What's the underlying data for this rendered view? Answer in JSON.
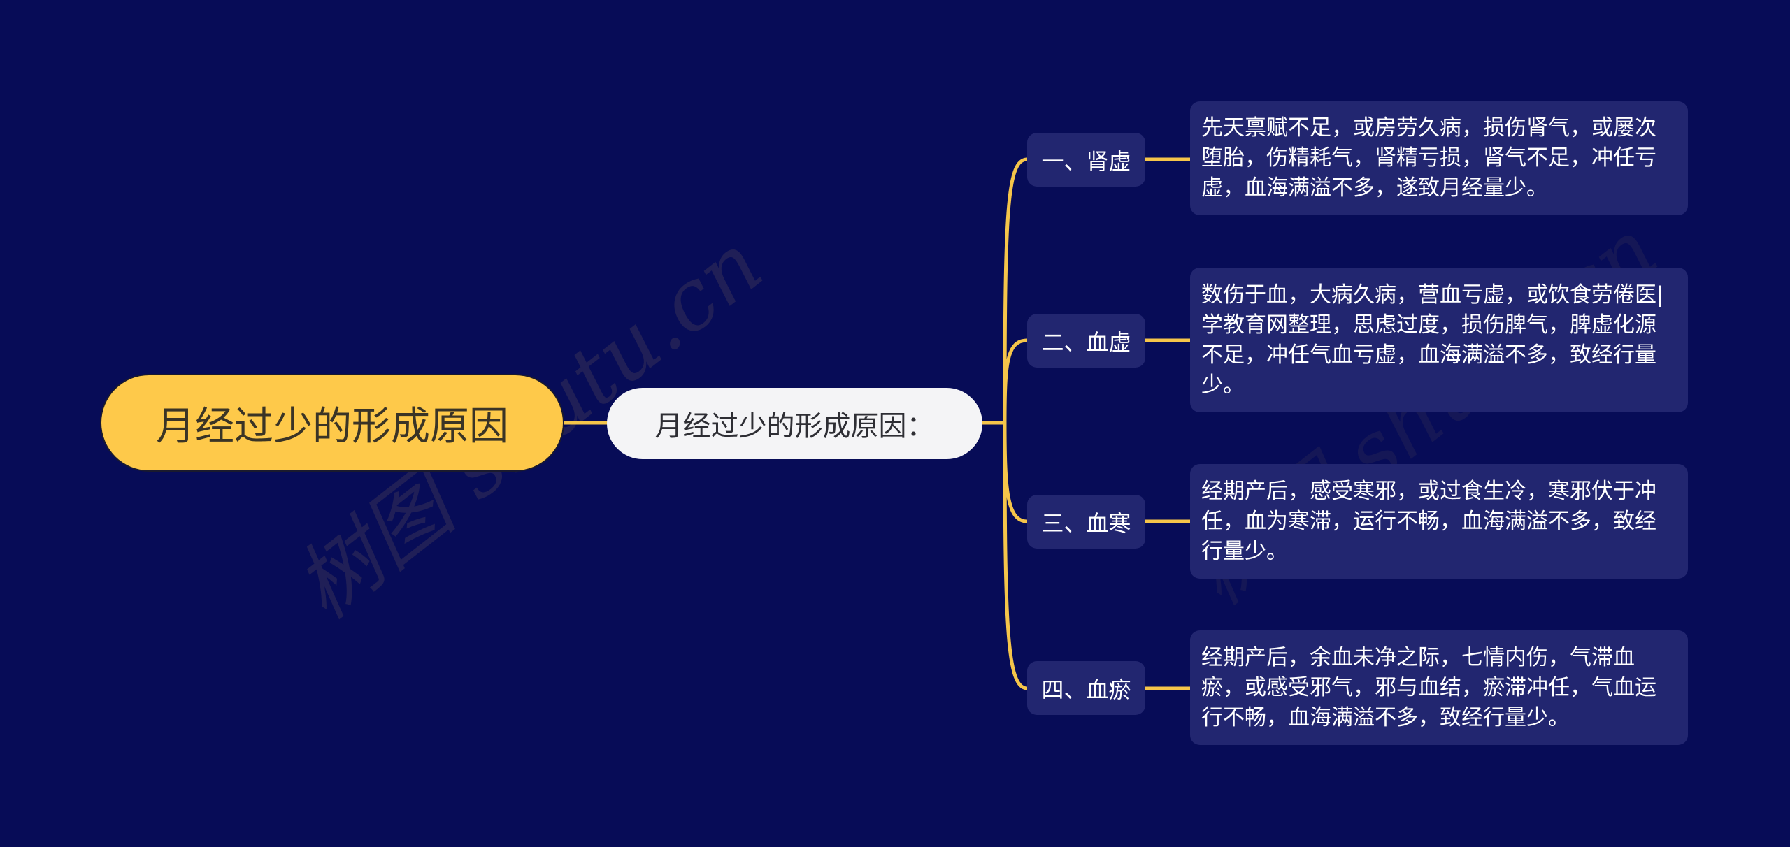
{
  "colors": {
    "background": "#070c57",
    "root_fill": "#fec94a",
    "child_fill": "#f4f4f6",
    "branch_fill": "#222670",
    "connector": "#f5c54a"
  },
  "watermark": "树图 shutu.cn",
  "root": {
    "label": "月经过少的形成原因"
  },
  "child": {
    "label": "月经过少的形成原因："
  },
  "branches": [
    {
      "label": "一、肾虚",
      "detail": "先天禀赋不足，或房劳久病，损伤肾气，或屡次堕胎，伤精耗气，肾精亏损，肾气不足，冲任亏虚，血海满溢不多，遂致月经量少。"
    },
    {
      "label": "二、血虚",
      "detail": "数伤于血，大病久病，营血亏虚，或饮食劳倦医|学教育网整理，思虑过度，损伤脾气，脾虚化源不足，冲任气血亏虚，血海满溢不多，致经行量少。"
    },
    {
      "label": "三、血寒",
      "detail": "经期产后，感受寒邪，或过食生冷，寒邪伏于冲任，血为寒滞，运行不畅，血海满溢不多，致经行量少。"
    },
    {
      "label": "四、血瘀",
      "detail": "经期产后，余血未净之际，七情内伤，气滞血瘀，或感受邪气，邪与血结，瘀滞冲任，气血运行不畅，血海满溢不多，致经行量少。"
    }
  ]
}
